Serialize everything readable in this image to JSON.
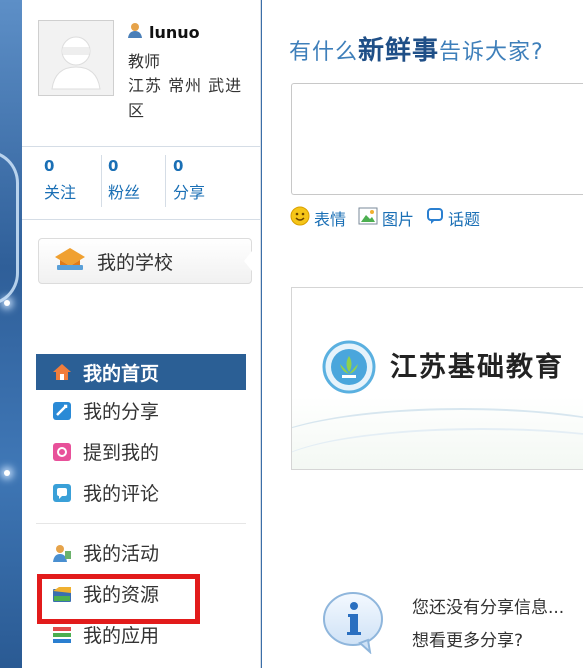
{
  "user": {
    "name": "lunuo",
    "role": "教师",
    "location": "江苏 常州 武进区"
  },
  "stats": [
    {
      "count": "0",
      "label": "关注"
    },
    {
      "count": "0",
      "label": "粉丝"
    },
    {
      "count": "0",
      "label": "分享"
    }
  ],
  "school_button": {
    "label": "我的学校"
  },
  "nav": {
    "primary": [
      {
        "label": "我的首页",
        "icon": "home-icon"
      },
      {
        "label": "我的分享",
        "icon": "share-icon"
      },
      {
        "label": "提到我的",
        "icon": "mention-icon"
      },
      {
        "label": "我的评论",
        "icon": "comment-icon"
      }
    ],
    "secondary": [
      {
        "label": "我的活动",
        "icon": "activity-icon"
      },
      {
        "label": "我的资源",
        "icon": "resource-icon"
      },
      {
        "label": "我的应用",
        "icon": "app-icon"
      }
    ]
  },
  "composer": {
    "prompt_plain_1": "有什么",
    "prompt_bold": "新鲜事",
    "prompt_plain_2": "告诉大家?",
    "tools": [
      {
        "label": "表情",
        "icon": "emoji-icon"
      },
      {
        "label": "图片",
        "icon": "image-icon"
      },
      {
        "label": "话题",
        "icon": "topic-icon"
      }
    ]
  },
  "banner": {
    "title": "江苏基础教育"
  },
  "empty_state": {
    "line1": "您还没有分享信息...",
    "line2": "想看更多分享?"
  },
  "colors": {
    "link": "#1a6fb5",
    "nav_active": "#2b5f95",
    "highlight": "#e21b1b",
    "prompt": "#3e7fba"
  }
}
